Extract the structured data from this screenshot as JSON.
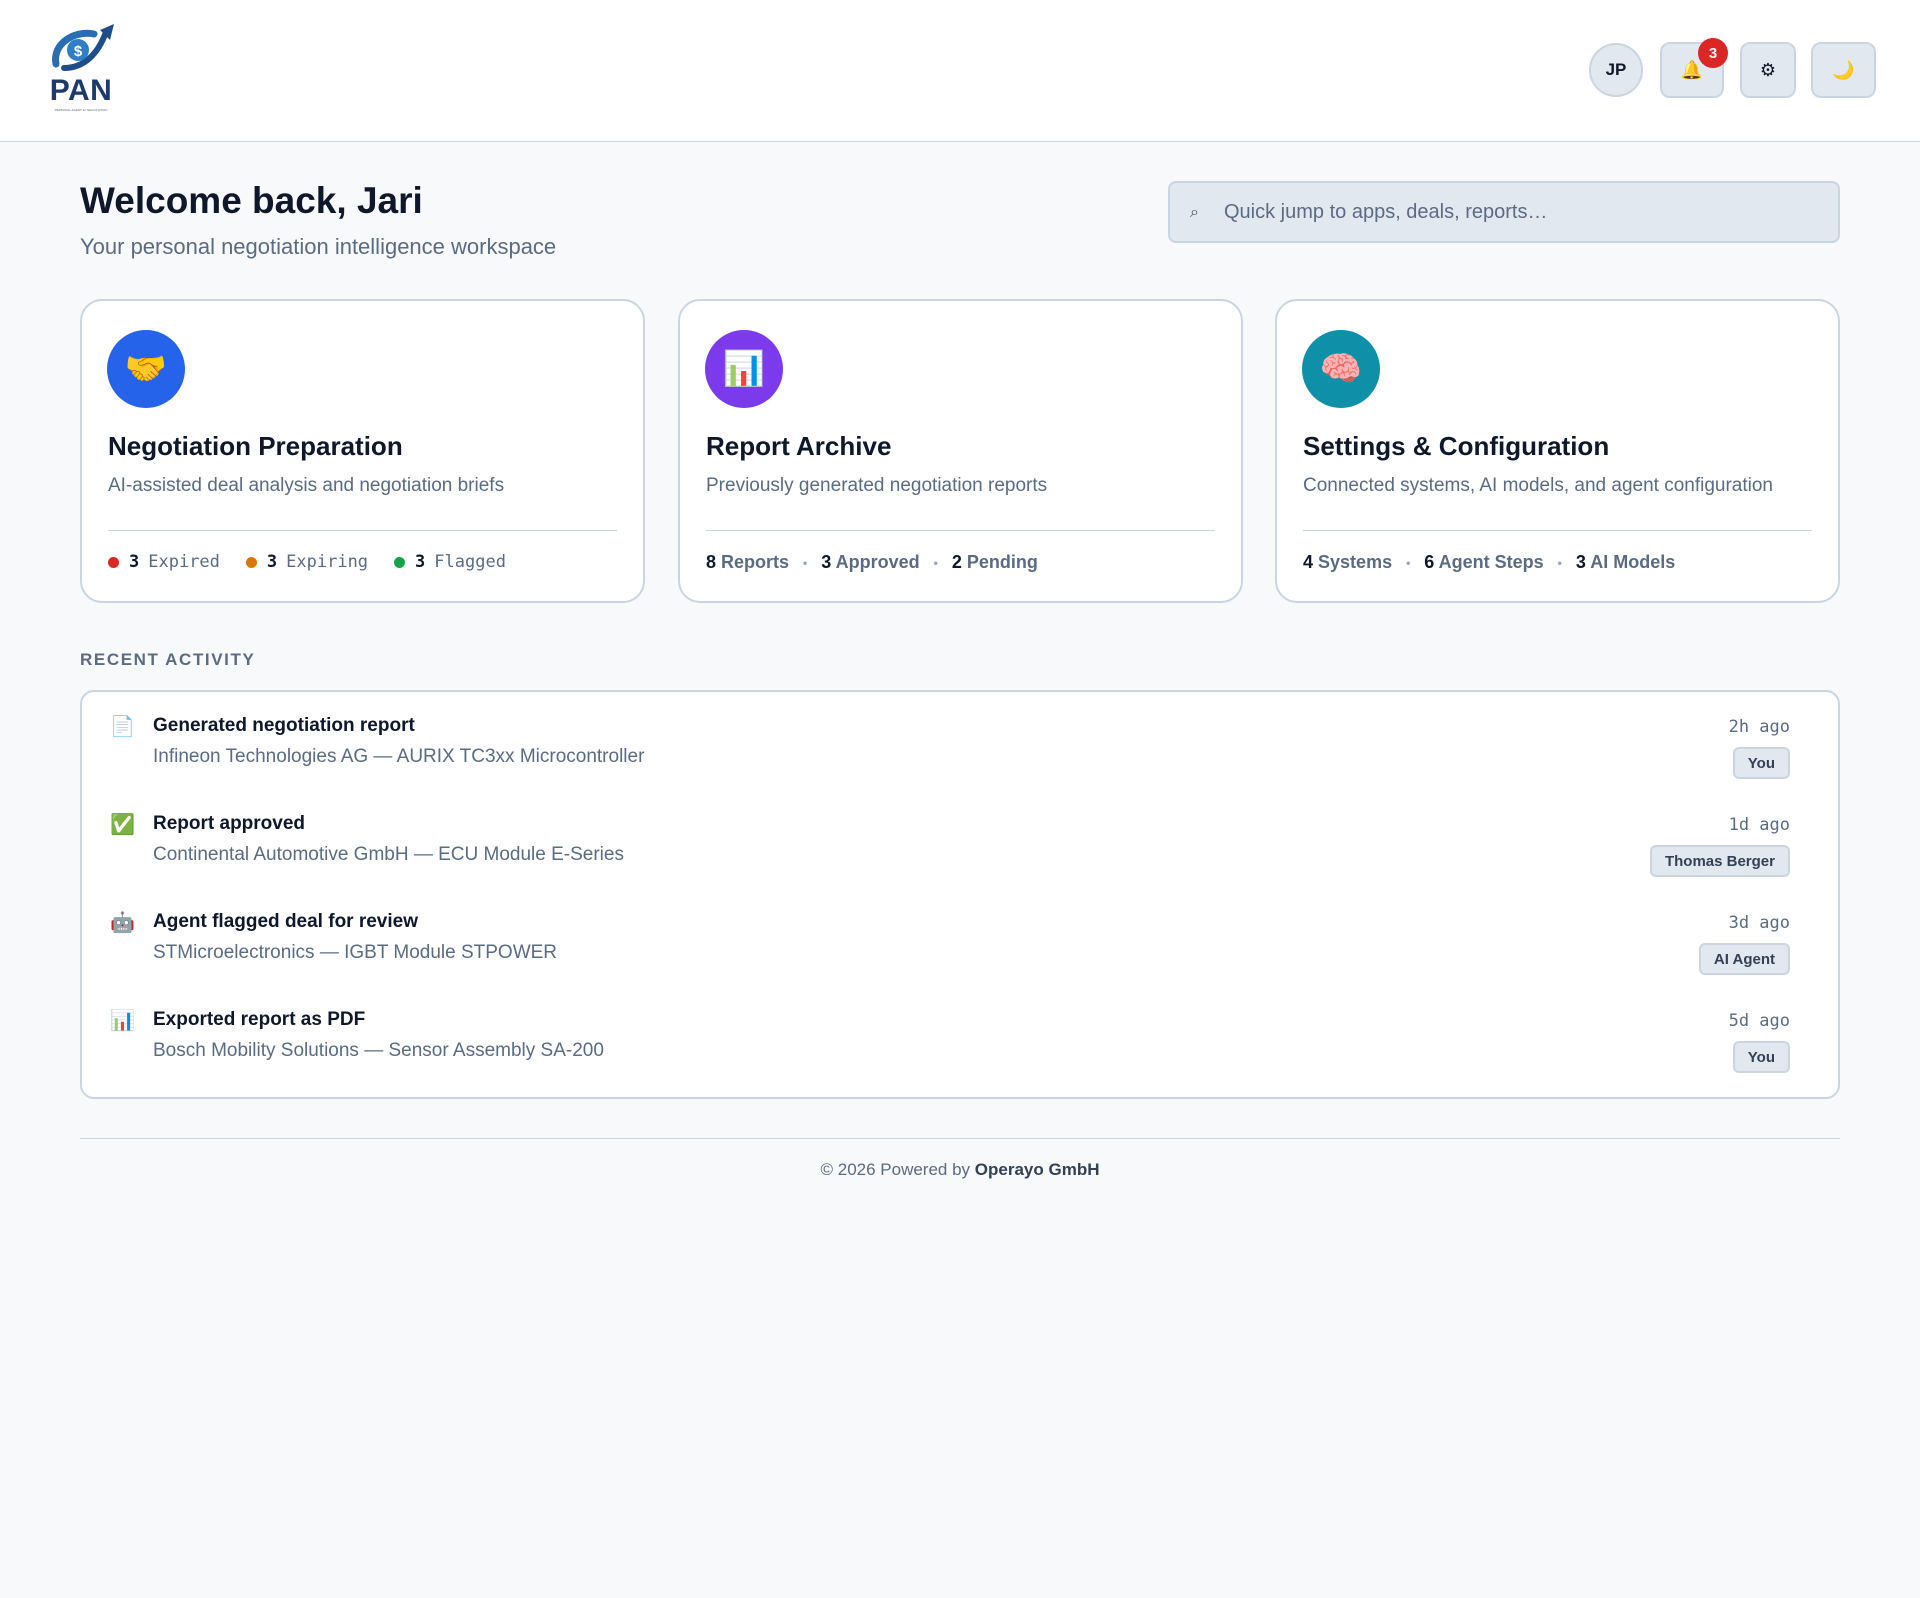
{
  "header": {
    "logo": {
      "wordmark": "PAN",
      "tagline": "PERSONAL AGENT for NEGOTIATION",
      "icon": "dollar-arrow-logo"
    },
    "user_initials": "JP",
    "notification_count": "3",
    "icons": {
      "bell": "🔔",
      "gear": "⚙",
      "moon": "🌙"
    }
  },
  "welcome": {
    "title": "Welcome back, Jari",
    "subtitle": "Your personal negotiation intelligence workspace"
  },
  "search": {
    "icon": "⌕",
    "placeholder": "Quick jump to apps, deals, reports…"
  },
  "cards": [
    {
      "icon": "🤝",
      "icon_bg": "#2563eb",
      "title": "Negotiation Preparation",
      "description": "AI-assisted deal analysis and negotiation briefs",
      "stats": [
        {
          "value": "3",
          "label": "Expired",
          "color": "#dc2626"
        },
        {
          "value": "3",
          "label": "Expiring",
          "color": "#d97706"
        },
        {
          "value": "3",
          "label": "Flagged",
          "color": "#16a34a"
        }
      ]
    },
    {
      "icon": "📊",
      "icon_bg": "#7c3aed",
      "title": "Report Archive",
      "description": "Previously generated negotiation reports",
      "stats": [
        {
          "value": "8",
          "label": "Reports"
        },
        {
          "value": "3",
          "label": "Approved"
        },
        {
          "value": "2",
          "label": "Pending"
        }
      ]
    },
    {
      "icon": "🧠",
      "icon_bg": "#0e90a8",
      "title": "Settings & Configuration",
      "description": "Connected systems, AI models, and agent configuration",
      "stats": [
        {
          "value": "4",
          "label": "Systems"
        },
        {
          "value": "6",
          "label": "Agent Steps"
        },
        {
          "value": "3",
          "label": "AI Models"
        }
      ]
    }
  ],
  "recent_activity": {
    "label": "RECENT ACTIVITY",
    "items": [
      {
        "icon": "📄",
        "title": "Generated negotiation report",
        "subtitle": "Infineon Technologies AG — AURIX TC3xx Microcontroller",
        "time": "2h ago",
        "who": "You"
      },
      {
        "icon": "✅",
        "title": "Report approved",
        "subtitle": "Continental Automotive GmbH — ECU Module E-Series",
        "time": "1d ago",
        "who": "Thomas Berger"
      },
      {
        "icon": "🤖",
        "title": "Agent flagged deal for review",
        "subtitle": "STMicroelectronics — IGBT Module STPOWER",
        "time": "3d ago",
        "who": "AI Agent"
      },
      {
        "icon": "📊",
        "title": "Exported report as PDF",
        "subtitle": "Bosch Mobility Solutions — Sensor Assembly SA-200",
        "time": "5d ago",
        "who": "You"
      }
    ]
  },
  "footer": {
    "prefix": "© 2026 Powered by",
    "company": "Operayo GmbH"
  }
}
